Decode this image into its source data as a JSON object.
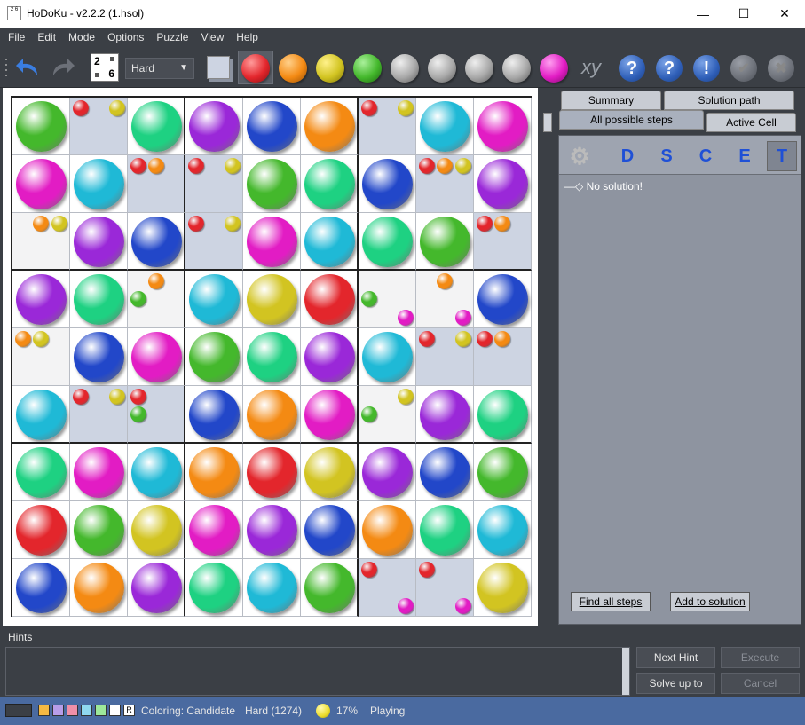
{
  "window": {
    "title": "HoDoKu - v2.2.2  (1.hsol)",
    "icon_text": "2 6"
  },
  "menu": [
    "File",
    "Edit",
    "Mode",
    "Options",
    "Puzzle",
    "View",
    "Help"
  ],
  "toolbar": {
    "level": "Hard",
    "icon_digits": [
      "2",
      "6"
    ],
    "xy_label": "xy",
    "help_marks": [
      "?",
      "?",
      "!"
    ],
    "check_mark": "✔",
    "x_mark": "✖"
  },
  "colors": {
    "red": "#e3262c",
    "orange": "#f48a13",
    "yellow": "#d2c421",
    "green": "#44b82c",
    "gray": "#a9a9a9",
    "magenta": "#e21cc4",
    "teal": "#1ed182",
    "cyan": "#1fb9d6",
    "purple": "#9a28d8",
    "blue": "#2247c9"
  },
  "grid": {
    "rows": [
      [
        {
          "v": "green"
        },
        {
          "hl": true,
          "c": [
            [
              "red",
              "tl"
            ],
            [
              "yellow",
              "tr"
            ]
          ]
        },
        {
          "v": "teal"
        },
        {
          "v": "purple"
        },
        {
          "v": "blue"
        },
        {
          "v": "orange"
        },
        {
          "hl": true,
          "c": [
            [
              "red",
              "tl"
            ],
            [
              "yellow",
              "tr"
            ]
          ]
        },
        {
          "v": "cyan"
        },
        {
          "v": "magenta"
        }
      ],
      [
        {
          "v": "magenta"
        },
        {
          "v": "cyan"
        },
        {
          "hl": true,
          "c": [
            [
              "red",
              "tl"
            ],
            [
              "orange",
              "tc"
            ]
          ]
        },
        {
          "hl": true,
          "c": [
            [
              "red",
              "tl"
            ],
            [
              "yellow",
              "tr"
            ]
          ]
        },
        {
          "v": "green"
        },
        {
          "v": "teal"
        },
        {
          "v": "blue"
        },
        {
          "hl": true,
          "c": [
            [
              "red",
              "tl"
            ],
            [
              "orange",
              "tc"
            ],
            [
              "yellow",
              "tr"
            ]
          ]
        },
        {
          "v": "purple"
        }
      ],
      [
        {
          "cand": true,
          "c": [
            [
              "orange",
              "tc"
            ],
            [
              "yellow",
              "tr"
            ]
          ]
        },
        {
          "v": "purple"
        },
        {
          "v": "blue"
        },
        {
          "hl": true,
          "c": [
            [
              "red",
              "tl"
            ],
            [
              "yellow",
              "tr"
            ]
          ]
        },
        {
          "v": "magenta"
        },
        {
          "v": "cyan"
        },
        {
          "v": "teal"
        },
        {
          "v": "green"
        },
        {
          "hl": true,
          "c": [
            [
              "red",
              "tl"
            ],
            [
              "orange",
              "tc"
            ]
          ]
        }
      ],
      [
        {
          "v": "purple"
        },
        {
          "v": "teal"
        },
        {
          "cand": true,
          "c": [
            [
              "orange",
              "tc"
            ],
            [
              "green",
              "ml"
            ]
          ]
        },
        {
          "v": "cyan"
        },
        {
          "v": "yellow"
        },
        {
          "v": "red"
        },
        {
          "cand": true,
          "c": [
            [
              "green",
              "ml"
            ],
            [
              "magenta",
              "br"
            ]
          ]
        },
        {
          "cand": true,
          "c": [
            [
              "orange",
              "tc"
            ],
            [
              "magenta",
              "br"
            ]
          ]
        },
        {
          "v": "blue"
        }
      ],
      [
        {
          "cand": true,
          "c": [
            [
              "orange",
              "tl"
            ],
            [
              "yellow",
              "tc"
            ]
          ]
        },
        {
          "v": "blue"
        },
        {
          "v": "magenta"
        },
        {
          "v": "green"
        },
        {
          "v": "teal"
        },
        {
          "v": "purple"
        },
        {
          "v": "cyan"
        },
        {
          "hl": true,
          "c": [
            [
              "red",
              "tl"
            ],
            [
              "yellow",
              "tr"
            ]
          ]
        },
        {
          "hl": true,
          "c": [
            [
              "red",
              "tl"
            ],
            [
              "orange",
              "tc"
            ]
          ]
        }
      ],
      [
        {
          "v": "cyan"
        },
        {
          "hl": true,
          "c": [
            [
              "red",
              "tl"
            ],
            [
              "yellow",
              "tr"
            ]
          ]
        },
        {
          "hl": true,
          "c": [
            [
              "red",
              "tl"
            ],
            [
              "green",
              "ml"
            ]
          ]
        },
        {
          "v": "blue"
        },
        {
          "v": "orange"
        },
        {
          "v": "magenta"
        },
        {
          "cand": true,
          "c": [
            [
              "yellow",
              "tr"
            ],
            [
              "green",
              "ml"
            ]
          ]
        },
        {
          "v": "purple"
        },
        {
          "v": "teal"
        }
      ],
      [
        {
          "v": "teal"
        },
        {
          "v": "magenta"
        },
        {
          "v": "cyan"
        },
        {
          "v": "orange"
        },
        {
          "v": "red"
        },
        {
          "v": "yellow"
        },
        {
          "v": "purple"
        },
        {
          "v": "blue"
        },
        {
          "v": "green"
        }
      ],
      [
        {
          "v": "red"
        },
        {
          "v": "green"
        },
        {
          "v": "yellow"
        },
        {
          "v": "magenta"
        },
        {
          "v": "purple"
        },
        {
          "v": "blue"
        },
        {
          "v": "orange"
        },
        {
          "v": "teal"
        },
        {
          "v": "cyan"
        }
      ],
      [
        {
          "v": "blue"
        },
        {
          "v": "orange"
        },
        {
          "v": "purple"
        },
        {
          "v": "teal"
        },
        {
          "v": "cyan"
        },
        {
          "v": "green"
        },
        {
          "hl": true,
          "c": [
            [
              "red",
              "tl"
            ],
            [
              "magenta",
              "br"
            ]
          ]
        },
        {
          "hl": true,
          "c": [
            [
              "red",
              "tl"
            ],
            [
              "magenta",
              "br"
            ]
          ]
        },
        {
          "v": "yellow"
        }
      ]
    ]
  },
  "panel": {
    "tabs_top": [
      "Summary",
      "Solution path"
    ],
    "tabs_bottom": [
      "All possible steps",
      "Active Cell"
    ],
    "step_buttons": [
      "D",
      "S",
      "C",
      "E",
      "T"
    ],
    "tree_item": "No solution!",
    "find_all": "Find all steps",
    "add_solution": "Add to solution"
  },
  "hints": {
    "label": "Hints",
    "next_hint": "Next Hint",
    "execute": "Execute",
    "solve_up_to": "Solve up to",
    "cancel": "Cancel"
  },
  "status": {
    "coloring": "Coloring: Candidate",
    "level": "Hard (1274)",
    "progress": "17%",
    "state": "Playing",
    "swatches": [
      "#f5b942",
      "#b79de8",
      "#f08fa8",
      "#8fd7ee",
      "#9de89a",
      "#ffffff"
    ],
    "reset_label": "R"
  }
}
